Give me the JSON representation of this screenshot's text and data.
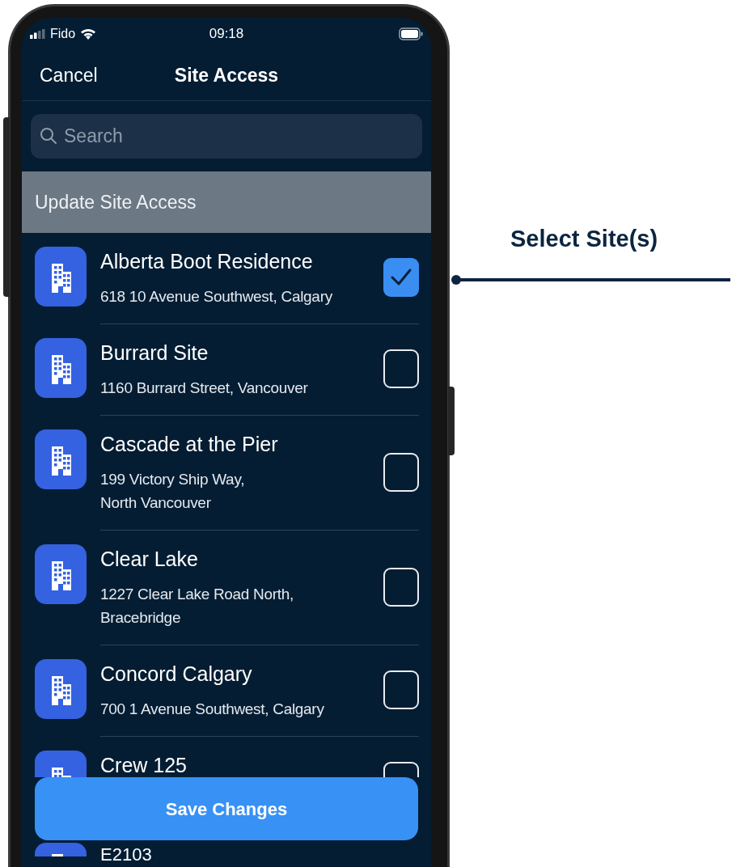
{
  "status_bar": {
    "carrier": "Fido",
    "time": "09:18"
  },
  "nav": {
    "cancel": "Cancel",
    "title": "Site Access"
  },
  "search": {
    "placeholder": "Search"
  },
  "section": {
    "title": "Update Site Access"
  },
  "sites": [
    {
      "kind": "full",
      "name": "Alberta Boot Residence",
      "address": [
        "618 10 Avenue Southwest, Calgary"
      ],
      "checked": true
    },
    {
      "kind": "full",
      "name": "Burrard Site",
      "address": [
        "1160 Burrard Street, Vancouver"
      ],
      "checked": false
    },
    {
      "kind": "full",
      "name": "Cascade at the Pier",
      "address": [
        "199 Victory Ship Way,",
        "North Vancouver"
      ],
      "checked": false
    },
    {
      "kind": "full",
      "name": "Clear Lake",
      "address": [
        "1227 Clear Lake Road North,",
        "Bracebridge"
      ],
      "checked": false
    },
    {
      "kind": "full",
      "name": "Concord Calgary",
      "address": [
        "700 1 Avenue Southwest, Calgary"
      ],
      "checked": false
    },
    {
      "kind": "cut_by_button",
      "name": "Crew 125",
      "checked": false
    },
    {
      "kind": "cut_by_edge",
      "name": "E2103"
    }
  ],
  "save_button": "Save Changes",
  "annotation": {
    "label": "Select Site(s)"
  }
}
